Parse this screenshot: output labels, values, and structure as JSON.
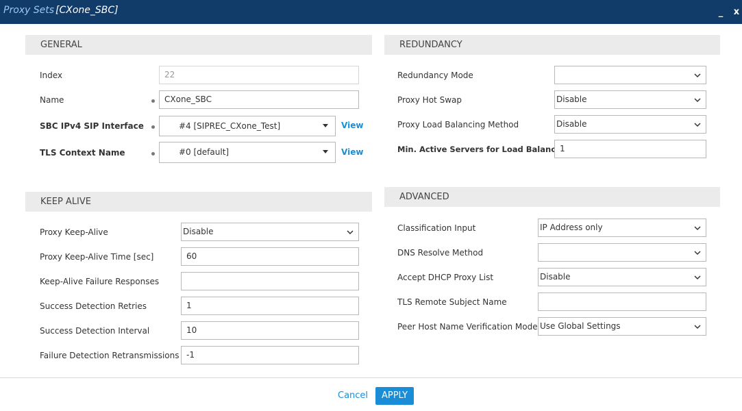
{
  "window": {
    "title_prefix": "Proxy Sets",
    "title_name": "[CXone_SBC]",
    "minimize_glyph": "_",
    "close_glyph": "x"
  },
  "general": {
    "heading": "GENERAL",
    "index_label": "Index",
    "index_value": "22",
    "name_label": "Name",
    "name_value": "CXone_SBC",
    "sip_interface_label": "SBC IPv4 SIP Interface",
    "sip_interface_value": "#4 [SIPREC_CXone_Test]",
    "tls_label": "TLS Context Name",
    "tls_value": "#0 [default]",
    "view_label": "View"
  },
  "keep_alive": {
    "heading": "KEEP ALIVE",
    "proxy_keepalive_label": "Proxy Keep-Alive",
    "proxy_keepalive_value": "Disable",
    "keepalive_time_label": "Proxy Keep-Alive Time [sec]",
    "keepalive_time_value": "60",
    "failure_responses_label": "Keep-Alive Failure Responses",
    "failure_responses_value": "",
    "success_retries_label": "Success Detection Retries",
    "success_retries_value": "1",
    "success_interval_label": "Success Detection Interval",
    "success_interval_value": "10",
    "failure_retrans_label": "Failure Detection Retransmissions",
    "failure_retrans_value": "-1"
  },
  "redundancy": {
    "heading": "REDUNDANCY",
    "mode_label": "Redundancy Mode",
    "mode_value": "",
    "hot_swap_label": "Proxy Hot Swap",
    "hot_swap_value": "Disable",
    "load_balancing_label": "Proxy Load Balancing Method",
    "load_balancing_value": "Disable",
    "min_active_label": "Min. Active Servers for Load Balancing",
    "min_active_value": "1"
  },
  "advanced": {
    "heading": "ADVANCED",
    "classification_label": "Classification Input",
    "classification_value": "IP Address only",
    "dns_label": "DNS Resolve Method",
    "dns_value": "",
    "dhcp_label": "Accept DHCP Proxy List",
    "dhcp_value": "Disable",
    "tls_subject_label": "TLS Remote Subject Name",
    "tls_subject_value": "",
    "peer_verify_label": "Peer Host Name Verification Mode",
    "peer_verify_value": "Use Global Settings"
  },
  "footer": {
    "cancel_label": "Cancel",
    "apply_label": "APPLY"
  },
  "colors": {
    "titlebar": "#113c6a",
    "accent": "#1a8dd6",
    "section_bg": "#ebebeb"
  },
  "icons": {
    "dropdown": "chevron-down-icon",
    "combo": "triangle-down-icon"
  }
}
